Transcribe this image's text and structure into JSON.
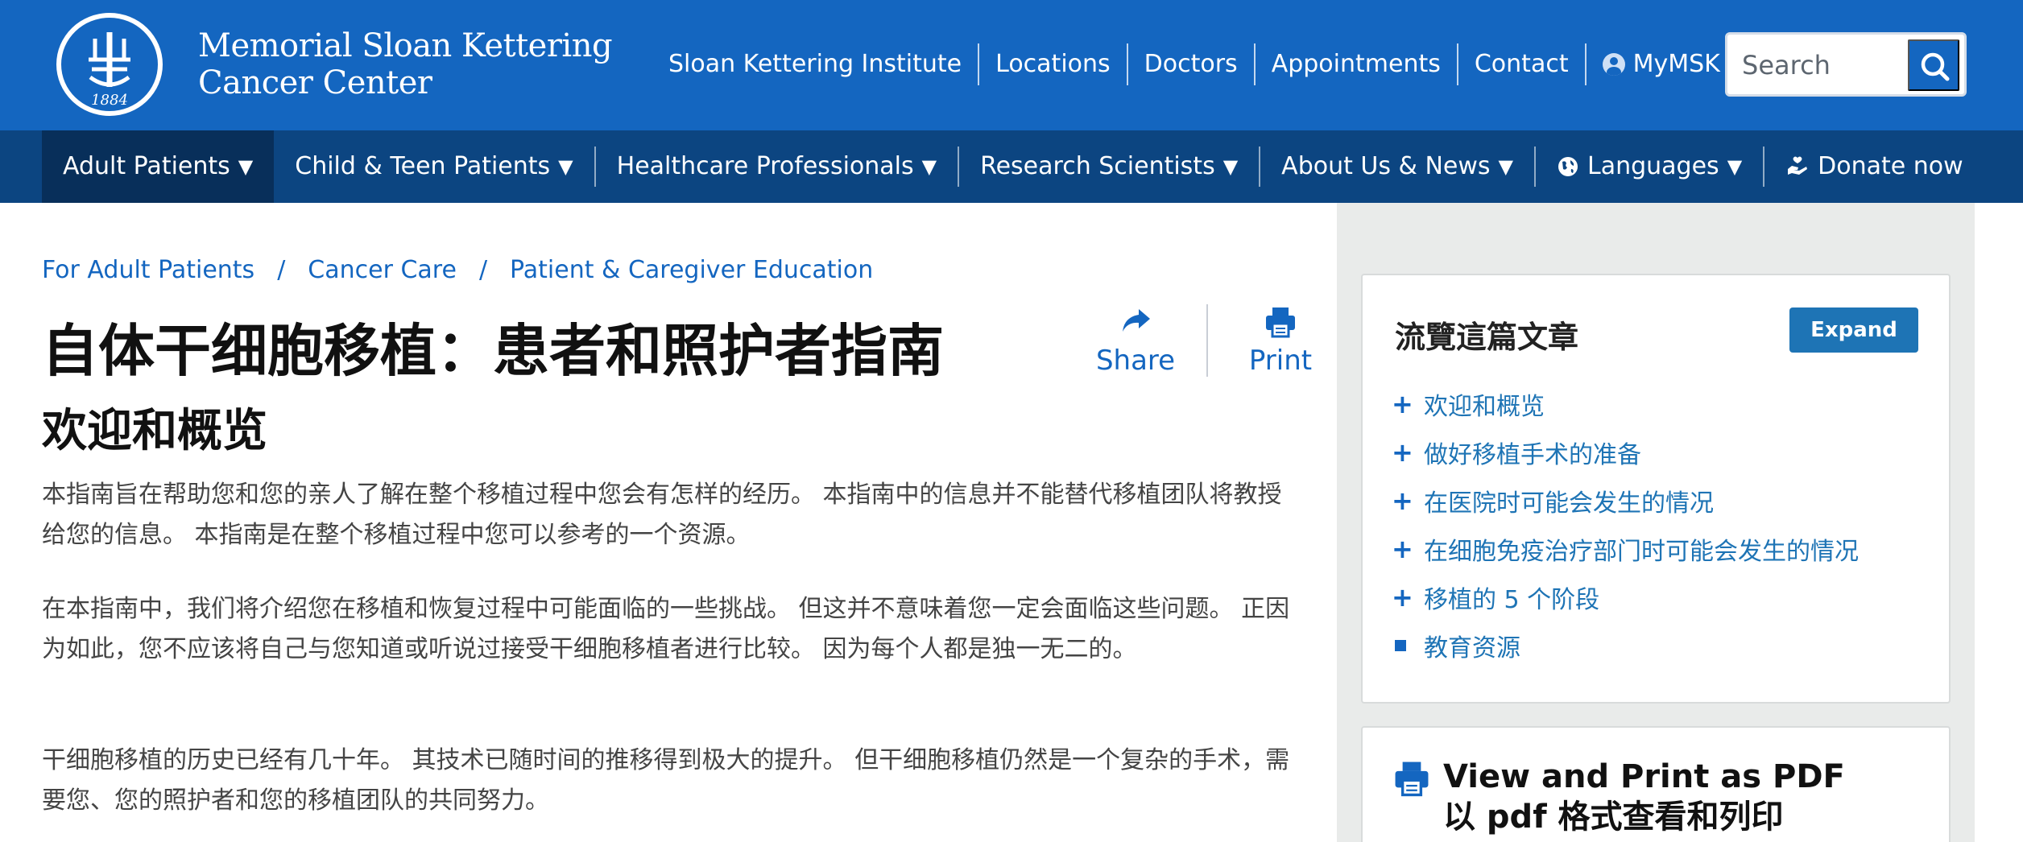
{
  "header": {
    "logo": {
      "line1": "Memorial Sloan Kettering",
      "line2": "Cancer Center",
      "year": "1884"
    },
    "utility_links": [
      "Sloan Kettering Institute",
      "Locations",
      "Doctors",
      "Appointments",
      "Contact"
    ],
    "mymsk_label": "MyMSK",
    "search": {
      "placeholder": "Search"
    }
  },
  "main_nav": {
    "items": [
      {
        "label": "Adult Patients",
        "active": true
      },
      {
        "label": "Child & Teen Patients"
      },
      {
        "label": "Healthcare Professionals"
      },
      {
        "label": "Research Scientists"
      },
      {
        "label": "About Us & News"
      },
      {
        "label": "Languages",
        "icon": "globe-icon"
      },
      {
        "label": "Donate now",
        "icon": "donate-icon"
      }
    ],
    "dropdown_glyph": "▼"
  },
  "breadcrumb": {
    "items": [
      "For Adult Patients",
      "Cancer Care",
      "Patient & Caregiver Education"
    ],
    "separator": "/"
  },
  "page": {
    "title": "自体干细胞移植：患者和照护者指南",
    "share_label": "Share",
    "print_label": "Print",
    "section_title": "欢迎和概览",
    "paragraphs": [
      "本指南旨在帮助您和您的亲人了解在整个移植过程中您会有怎样的经历。 本指南中的信息并不能替代移植团队将教授给您的信息。 本指南是在整个移植过程中您可以参考的一个资源。",
      "在本指南中，我们将介绍您在移植和恢复过程中可能面临的一些挑战。 但这并不意味着您一定会面临这些问题。 正因为如此，您不应该将自己与您知道或听说过接受干细胞移植者进行比较。 因为每个人都是独一无二的。",
      "干细胞移植的历史已经有几十年。 其技术已随时间的推移得到极大的提升。 但干细胞移植仍然是一个复杂的手术，需要您、您的照护者和您的移植团队的共同努力。"
    ]
  },
  "sidebar": {
    "toc_title": "流覽這篇文章",
    "expand_label": "Expand",
    "toc_items": [
      {
        "label": "欢迎和概览",
        "bullet": "+"
      },
      {
        "label": "做好移植手术的准备",
        "bullet": "+"
      },
      {
        "label": "在医院时可能会发生的情况",
        "bullet": "+"
      },
      {
        "label": "在细胞免疫治疗部门时可能会发生的情况",
        "bullet": "+"
      },
      {
        "label": "移植的 5 个阶段",
        "bullet": "+"
      },
      {
        "label": "教育资源",
        "bullet": "square"
      }
    ],
    "pdf_title_line1": "View and Print as PDF",
    "pdf_title_line2": "以 pdf 格式查看和列印"
  },
  "colors": {
    "header_blue": "#1466c0",
    "nav_dark_blue": "#0c4581",
    "nav_active": "#082f5a",
    "link_blue": "#1e74b5",
    "sidebar_bg": "#e9ebea"
  }
}
